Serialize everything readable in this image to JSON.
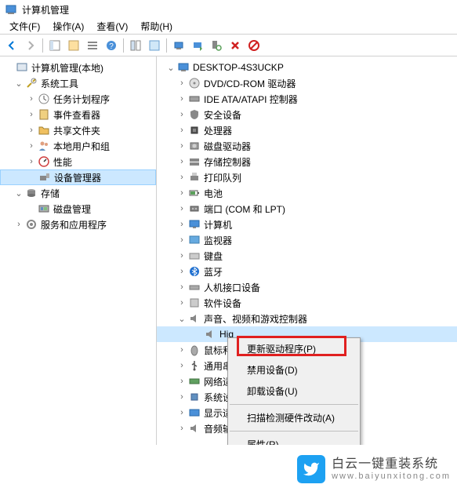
{
  "title": "计算机管理",
  "menus": {
    "file": "文件(F)",
    "action": "操作(A)",
    "view": "查看(V)",
    "help": "帮助(H)"
  },
  "left_tree": {
    "root": "计算机管理(本地)",
    "sys_tools": "系统工具",
    "task_sched": "任务计划程序",
    "event_viewer": "事件查看器",
    "shared_folders": "共享文件夹",
    "local_users": "本地用户和组",
    "performance": "性能",
    "device_mgr": "设备管理器",
    "storage": "存储",
    "disk_mgmt": "磁盘管理",
    "services": "服务和应用程序"
  },
  "right_tree": {
    "computer": "DESKTOP-4S3UCKP",
    "dvd": "DVD/CD-ROM 驱动器",
    "ide": "IDE ATA/ATAPI 控制器",
    "security": "安全设备",
    "cpu": "处理器",
    "disk": "磁盘驱动器",
    "storage_ctrl": "存储控制器",
    "print_queue": "打印队列",
    "battery": "电池",
    "ports": "端口 (COM 和 LPT)",
    "computers": "计算机",
    "monitor": "监视器",
    "keyboard": "键盘",
    "bluetooth": "蓝牙",
    "hid": "人机接口设备",
    "software": "软件设备",
    "sound": "声音、视频和游戏控制器",
    "sound_device": "Hig",
    "mouse": "鼠标和",
    "serial": "通用串",
    "network": "网络适",
    "sys_devices": "系统设",
    "display": "显示适",
    "audio_in": "音频输"
  },
  "context_menu": {
    "update": "更新驱动程序(P)",
    "disable": "禁用设备(D)",
    "uninstall": "卸载设备(U)",
    "scan": "扫描检测硬件改动(A)",
    "properties": "属性(R)"
  },
  "watermark": {
    "main": "白云一键重装系统",
    "url": "www.baiyunxitong.com"
  }
}
